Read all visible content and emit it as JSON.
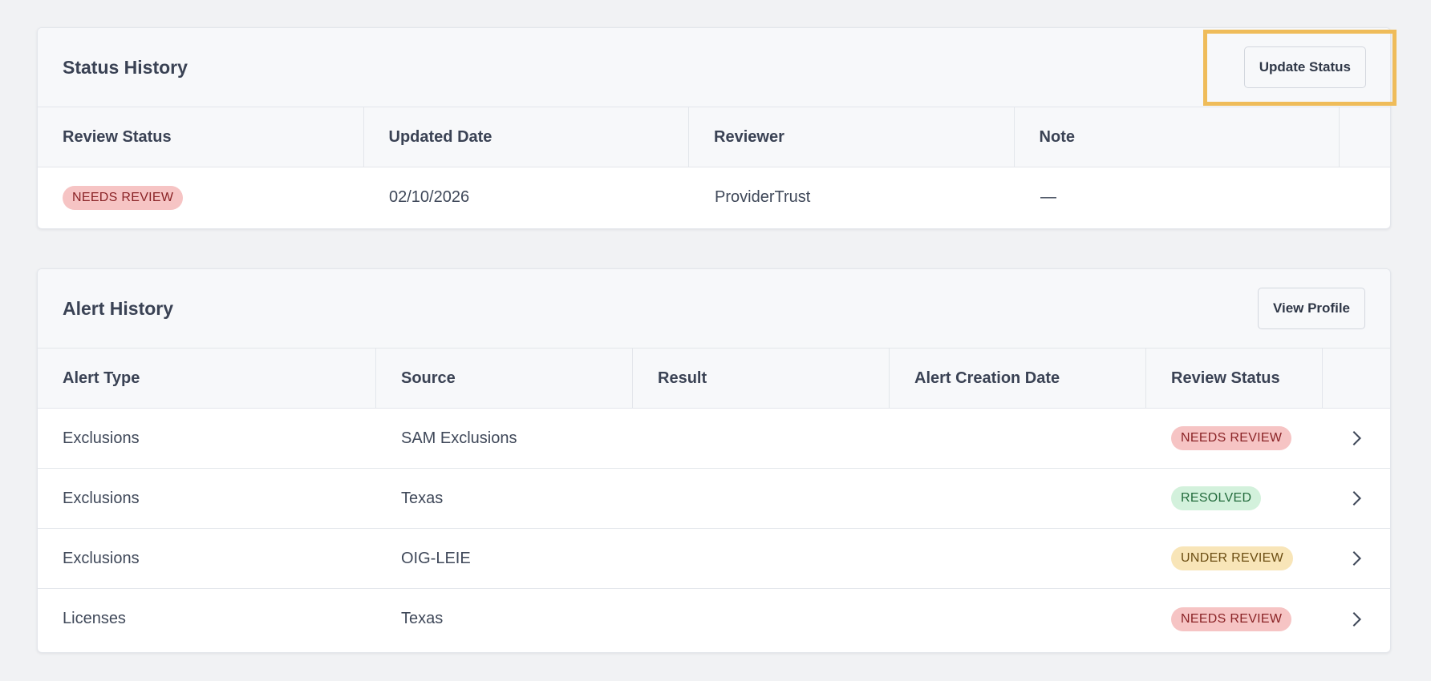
{
  "status_history": {
    "title": "Status History",
    "update_button": "Update Status",
    "columns": [
      "Review Status",
      "Updated Date",
      "Reviewer",
      "Note"
    ],
    "rows": [
      {
        "review_status": "NEEDS REVIEW",
        "updated_date": "02/10/2026",
        "reviewer": "ProviderTrust",
        "note": "—"
      }
    ]
  },
  "alert_history": {
    "title": "Alert History",
    "view_button": "View Profile",
    "columns": [
      "Alert Type",
      "Source",
      "Result",
      "Alert Creation Date",
      "Review Status"
    ],
    "rows": [
      {
        "alert_type": "Exclusions",
        "source": "SAM Exclusions",
        "result": "",
        "created": "",
        "review_status": "NEEDS REVIEW"
      },
      {
        "alert_type": "Exclusions",
        "source": "Texas",
        "result": "",
        "created": "",
        "review_status": "RESOLVED"
      },
      {
        "alert_type": "Exclusions",
        "source": "OIG-LEIE",
        "result": "",
        "created": "",
        "review_status": "UNDER REVIEW"
      },
      {
        "alert_type": "Licenses",
        "source": "Texas",
        "result": "",
        "created": "",
        "review_status": "NEEDS REVIEW"
      }
    ]
  },
  "icons": {
    "row_action": "chevron-right-icon"
  },
  "colors": {
    "needs_review_bg": "#f6c4c4",
    "needs_review_fg": "#8a2326",
    "resolved_bg": "#d3f1dc",
    "resolved_fg": "#236b3c",
    "under_review_bg": "#f8e5b8",
    "under_review_fg": "#6b4d12",
    "highlight": "#efbc5a"
  }
}
